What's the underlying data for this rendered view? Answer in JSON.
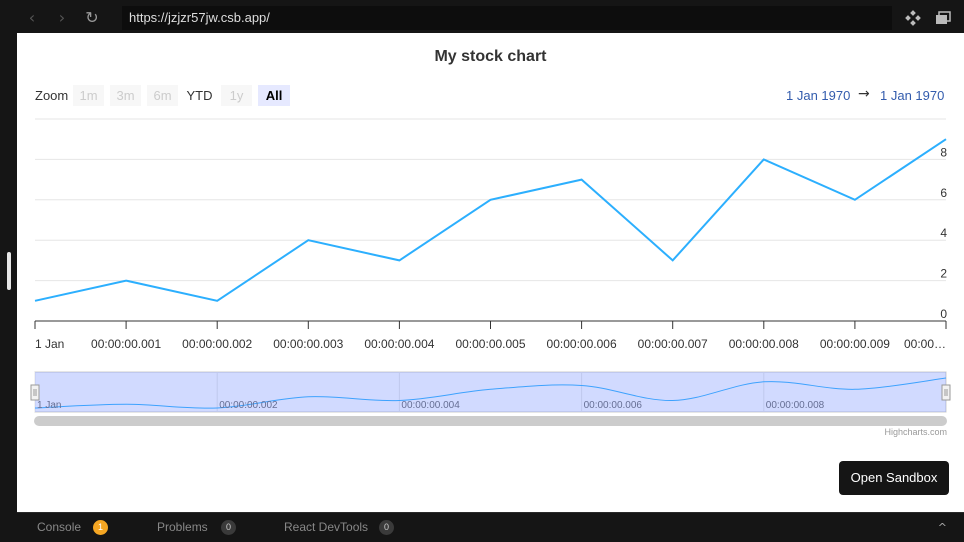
{
  "browser": {
    "url": "https://jzjzr57jw.csb.app/",
    "back_glyph": "‹",
    "forward_glyph": "›",
    "reload_glyph": "↻"
  },
  "page": {
    "open_sandbox_label": "Open Sandbox"
  },
  "bottom_tabs": [
    {
      "label": "Console",
      "badge": "1"
    },
    {
      "label": "Problems",
      "badge": "0"
    },
    {
      "label": "React DevTools",
      "badge": "0"
    }
  ],
  "bottom_chevron": "^",
  "range_selector": {
    "zoom_label": "Zoom",
    "buttons": [
      "1m",
      "3m",
      "6m",
      "YTD",
      "1y",
      "All"
    ],
    "enabled": [
      false,
      false,
      false,
      true,
      false,
      true
    ],
    "selected": "All",
    "from": "1 Jan 1970",
    "arrow": "→",
    "to": "1 Jan 1970"
  },
  "credits": "Highcharts.com",
  "colors": {
    "series": "#2caffe",
    "navigator_mask": "rgba(102,133,255,0.3)",
    "scrollbar": "#cccccc",
    "range_text": "#335cad"
  },
  "chart_data": {
    "type": "line",
    "title": "My stock chart",
    "x": [
      0,
      1,
      2,
      3,
      4,
      5,
      6,
      7,
      8,
      9,
      10
    ],
    "x_tick_labels": [
      "1 Jan",
      "00:00:00.001",
      "00:00:00.002",
      "00:00:00.003",
      "00:00:00.004",
      "00:00:00.005",
      "00:00:00.006",
      "00:00:00.007",
      "00:00:00.008",
      "00:00:00.009",
      "00:00…"
    ],
    "values": [
      1,
      2,
      1,
      4,
      3,
      6,
      7,
      3,
      8,
      6,
      9
    ],
    "ylim": [
      0,
      10
    ],
    "y_ticks": [
      0,
      2,
      4,
      6,
      8
    ],
    "grid": true,
    "navigator_tick_labels": [
      "1 Jan",
      "00:00:00.002",
      "00:00:00.004",
      "00:00:00.006",
      "00:00:00.008"
    ]
  }
}
